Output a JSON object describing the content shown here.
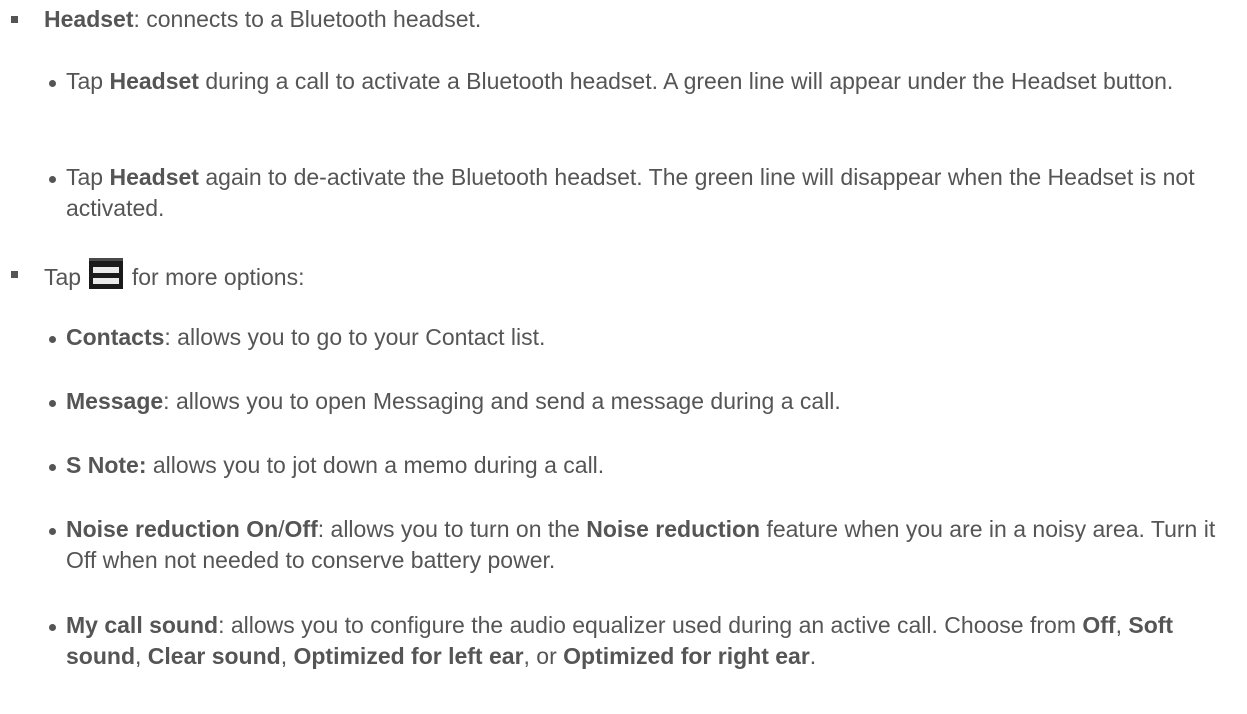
{
  "section1": {
    "title": "Headset",
    "desc": ": connects to a Bluetooth headset.",
    "subs": [
      {
        "pre": "Tap ",
        "bold": "Headset",
        "post": " during a call to activate a Bluetooth headset. A green line will appear under the Headset button."
      },
      {
        "pre": "Tap ",
        "bold": "Headset",
        "post": " again to de-activate the Bluetooth headset. The green line will disappear when the Headset is not activated."
      }
    ]
  },
  "section2": {
    "pre": "Tap ",
    "icon": "menu-icon",
    "post": " for more options:",
    "options": [
      {
        "bold": "Contacts",
        "text": ": allows you to go to your Contact list."
      },
      {
        "bold": "Message",
        "text": ": allows you to open Messaging and send a message during a call."
      },
      {
        "bold": "S Note:",
        "text": " allows you to jot down a memo during a call."
      },
      {
        "bold_a": "Noise reduction On",
        "sep": "/",
        "bold_b": "Off",
        "text_a": ": allows you to turn on the ",
        "bold_c": "Noise reduction",
        "text_b": " feature when you are in a noisy area. Turn it Off when not needed to conserve battery power."
      },
      {
        "bold": "My call sound",
        "text": ": allows you to configure the audio equalizer used during an active call. Choose from ",
        "choices": [
          "Off",
          "Soft sound",
          "Clear sound",
          "Optimized for left ear",
          "Optimized for right ear"
        ],
        "sep1": ", ",
        "sep2": ", ",
        "sep3": ", ",
        "sep4": ", or ",
        "end": "."
      }
    ]
  }
}
